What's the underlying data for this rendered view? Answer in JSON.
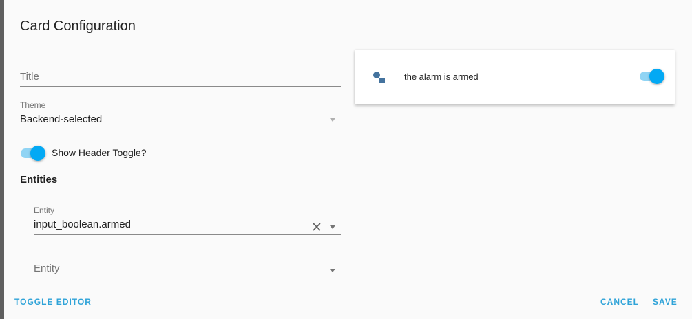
{
  "dialog": {
    "title": "Card Configuration",
    "accent_color": "#03a9f4",
    "button_color": "#2fa3d8"
  },
  "form": {
    "title_field": {
      "placeholder": "Title",
      "value": ""
    },
    "theme_field": {
      "label": "Theme",
      "value": "Backend-selected"
    },
    "show_header_toggle": {
      "label": "Show Header Toggle?",
      "checked": true
    },
    "entities_heading": "Entities",
    "entities": [
      {
        "label": "Entity",
        "value": "input_boolean.armed",
        "clear_icon": "close-icon"
      },
      {
        "placeholder": "Entity",
        "value": ""
      }
    ]
  },
  "preview": {
    "icon": "shapes-icon",
    "entity_name": "the alarm is armed",
    "toggle_on": true
  },
  "actions": {
    "toggle_editor": "TOGGLE EDITOR",
    "cancel": "CANCEL",
    "save": "SAVE"
  }
}
